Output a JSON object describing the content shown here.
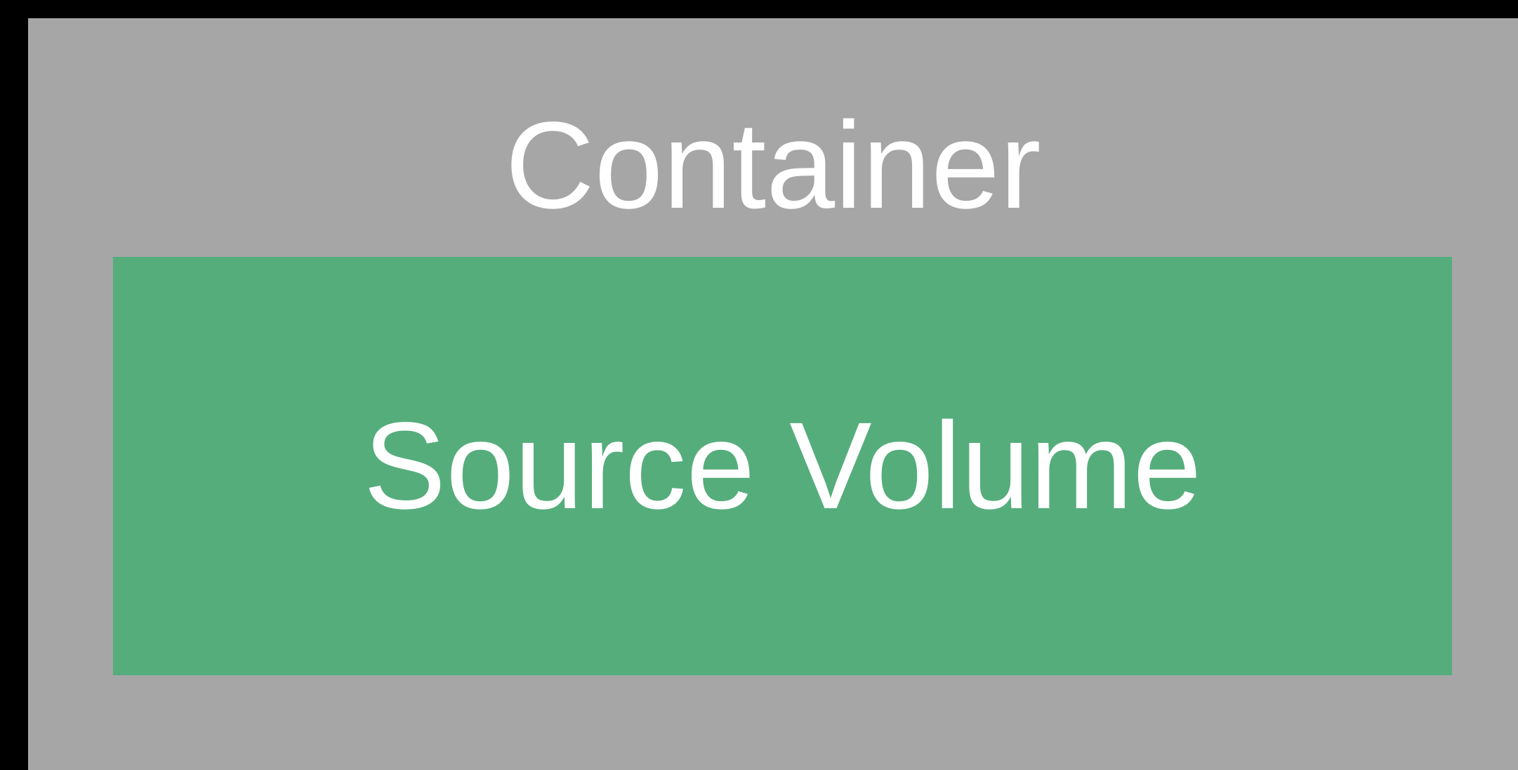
{
  "diagram": {
    "outer": {
      "label": "Container",
      "fill_color": "#a6a6a6"
    },
    "inner": {
      "label": "Source Volume",
      "fill_color": "#55ad7c"
    },
    "background_color": "#000000",
    "text_color": "#ffffff"
  }
}
